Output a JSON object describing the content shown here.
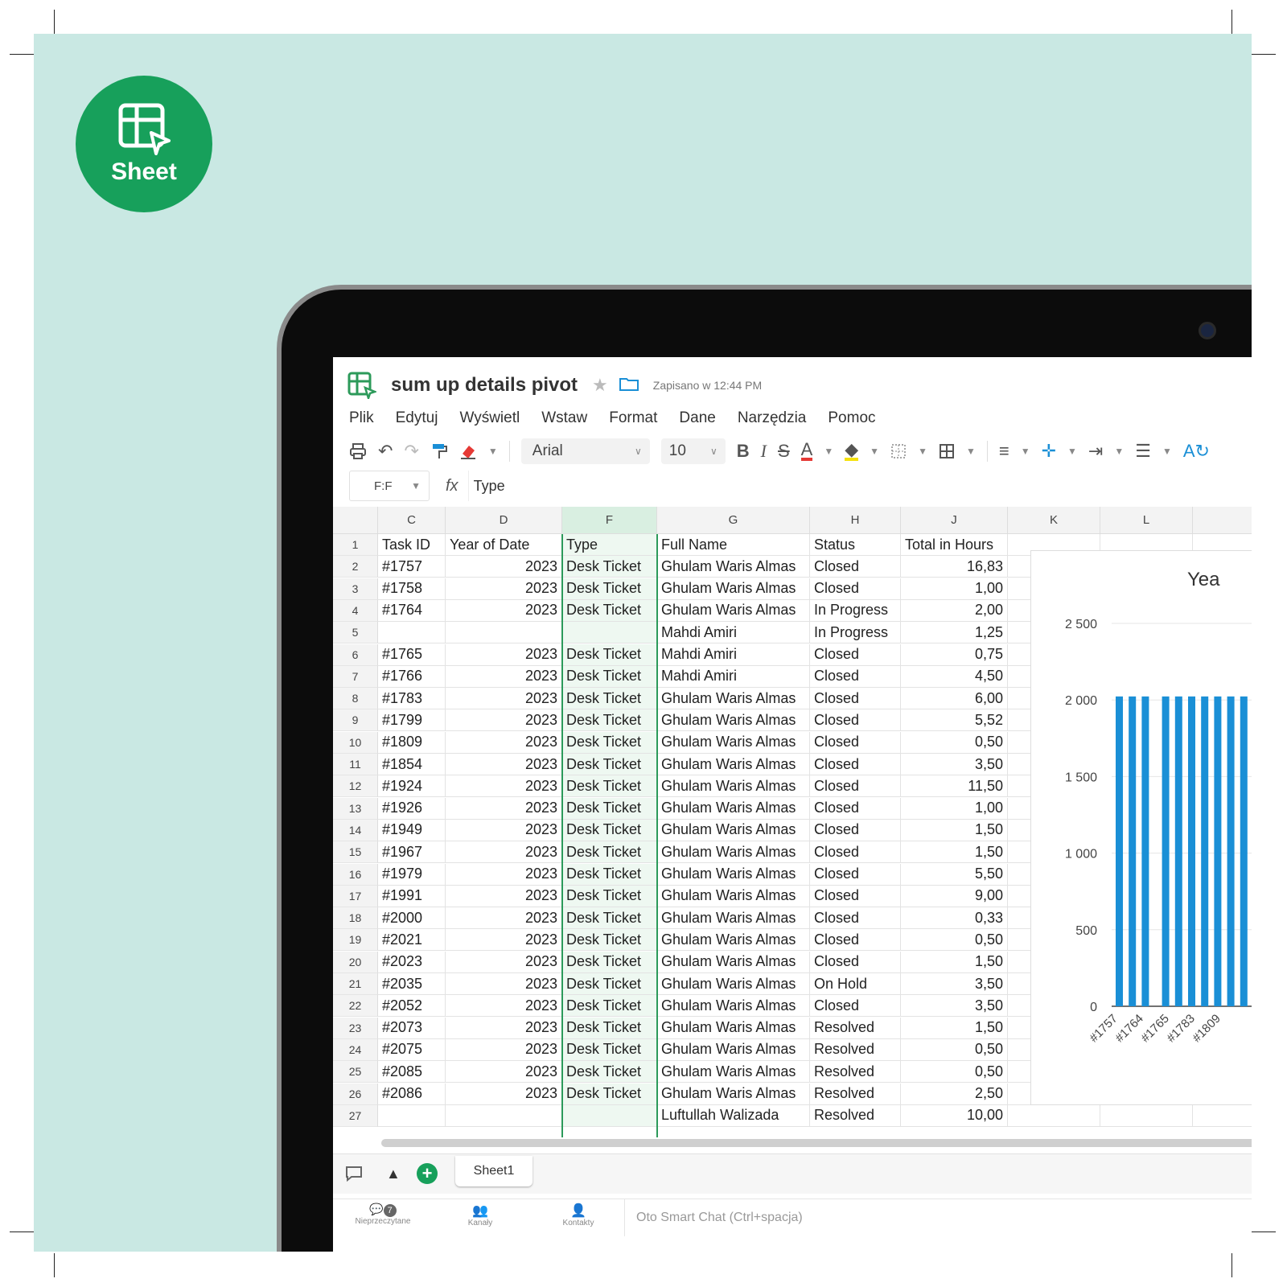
{
  "logo": {
    "label": "Sheet",
    "color": "#17a05b"
  },
  "app": {
    "title": "sum up details pivot",
    "saved_status": "Zapisano w 12:44 PM",
    "menu": [
      "Plik",
      "Edytuj",
      "Wyświetl",
      "Wstaw",
      "Format",
      "Dane",
      "Narzędzia",
      "Pomoc"
    ],
    "toolbar": {
      "font": "Arial",
      "font_size": "10"
    },
    "formula_bar": {
      "cell_ref": "F:F",
      "fx": "fx",
      "value": "Type"
    }
  },
  "grid": {
    "columns": [
      "C",
      "D",
      "F",
      "G",
      "H",
      "J",
      "K",
      "L"
    ],
    "selected_column": "F",
    "header_row": [
      "Task ID",
      "Year of Date",
      "Type",
      "Full Name",
      "Status",
      "Total in Hours"
    ],
    "rows": [
      {
        "n": "1",
        "c": "Task ID",
        "d": "Year of Date",
        "f": "Type",
        "g": "Full Name",
        "h": "Status",
        "j": "Total in Hours"
      },
      {
        "n": "2",
        "c": "#1757",
        "d": "2023",
        "f": "Desk Ticket",
        "g": "Ghulam Waris Almas",
        "h": "Closed",
        "j": "16,83"
      },
      {
        "n": "3",
        "c": "#1758",
        "d": "2023",
        "f": "Desk Ticket",
        "g": "Ghulam Waris Almas",
        "h": "Closed",
        "j": "1,00"
      },
      {
        "n": "4",
        "c": "#1764",
        "d": "2023",
        "f": "Desk Ticket",
        "g": "Ghulam Waris Almas",
        "h": "In Progress",
        "j": "2,00"
      },
      {
        "n": "5",
        "c": "",
        "d": "",
        "f": "",
        "g": "Mahdi Amiri",
        "h": "In Progress",
        "j": "1,25"
      },
      {
        "n": "6",
        "c": "#1765",
        "d": "2023",
        "f": "Desk Ticket",
        "g": "Mahdi Amiri",
        "h": "Closed",
        "j": "0,75"
      },
      {
        "n": "7",
        "c": "#1766",
        "d": "2023",
        "f": "Desk Ticket",
        "g": "Mahdi Amiri",
        "h": "Closed",
        "j": "4,50"
      },
      {
        "n": "8",
        "c": "#1783",
        "d": "2023",
        "f": "Desk Ticket",
        "g": "Ghulam Waris Almas",
        "h": "Closed",
        "j": "6,00"
      },
      {
        "n": "9",
        "c": "#1799",
        "d": "2023",
        "f": "Desk Ticket",
        "g": "Ghulam Waris Almas",
        "h": "Closed",
        "j": "5,52"
      },
      {
        "n": "10",
        "c": "#1809",
        "d": "2023",
        "f": "Desk Ticket",
        "g": "Ghulam Waris Almas",
        "h": "Closed",
        "j": "0,50"
      },
      {
        "n": "11",
        "c": "#1854",
        "d": "2023",
        "f": "Desk Ticket",
        "g": "Ghulam Waris Almas",
        "h": "Closed",
        "j": "3,50"
      },
      {
        "n": "12",
        "c": "#1924",
        "d": "2023",
        "f": "Desk Ticket",
        "g": "Ghulam Waris Almas",
        "h": "Closed",
        "j": "11,50"
      },
      {
        "n": "13",
        "c": "#1926",
        "d": "2023",
        "f": "Desk Ticket",
        "g": "Ghulam Waris Almas",
        "h": "Closed",
        "j": "1,00"
      },
      {
        "n": "14",
        "c": "#1949",
        "d": "2023",
        "f": "Desk Ticket",
        "g": "Ghulam Waris Almas",
        "h": "Closed",
        "j": "1,50"
      },
      {
        "n": "15",
        "c": "#1967",
        "d": "2023",
        "f": "Desk Ticket",
        "g": "Ghulam Waris Almas",
        "h": "Closed",
        "j": "1,50"
      },
      {
        "n": "16",
        "c": "#1979",
        "d": "2023",
        "f": "Desk Ticket",
        "g": "Ghulam Waris Almas",
        "h": "Closed",
        "j": "5,50"
      },
      {
        "n": "17",
        "c": "#1991",
        "d": "2023",
        "f": "Desk Ticket",
        "g": "Ghulam Waris Almas",
        "h": "Closed",
        "j": "9,00"
      },
      {
        "n": "18",
        "c": "#2000",
        "d": "2023",
        "f": "Desk Ticket",
        "g": "Ghulam Waris Almas",
        "h": "Closed",
        "j": "0,33"
      },
      {
        "n": "19",
        "c": "#2021",
        "d": "2023",
        "f": "Desk Ticket",
        "g": "Ghulam Waris Almas",
        "h": "Closed",
        "j": "0,50"
      },
      {
        "n": "20",
        "c": "#2023",
        "d": "2023",
        "f": "Desk Ticket",
        "g": "Ghulam Waris Almas",
        "h": "Closed",
        "j": "1,50"
      },
      {
        "n": "21",
        "c": "#2035",
        "d": "2023",
        "f": "Desk Ticket",
        "g": "Ghulam Waris Almas",
        "h": "On Hold",
        "j": "3,50"
      },
      {
        "n": "22",
        "c": "#2052",
        "d": "2023",
        "f": "Desk Ticket",
        "g": "Ghulam Waris Almas",
        "h": "Closed",
        "j": "3,50"
      },
      {
        "n": "23",
        "c": "#2073",
        "d": "2023",
        "f": "Desk Ticket",
        "g": "Ghulam Waris Almas",
        "h": "Resolved",
        "j": "1,50"
      },
      {
        "n": "24",
        "c": "#2075",
        "d": "2023",
        "f": "Desk Ticket",
        "g": "Ghulam Waris Almas",
        "h": "Resolved",
        "j": "0,50"
      },
      {
        "n": "25",
        "c": "#2085",
        "d": "2023",
        "f": "Desk Ticket",
        "g": "Ghulam Waris Almas",
        "h": "Resolved",
        "j": "0,50"
      },
      {
        "n": "26",
        "c": "#2086",
        "d": "2023",
        "f": "Desk Ticket",
        "g": "Ghulam Waris Almas",
        "h": "Resolved",
        "j": "2,50"
      },
      {
        "n": "27",
        "c": "",
        "d": "",
        "f": "",
        "g": "Luftullah Walizada",
        "h": "Resolved",
        "j": "10,00"
      }
    ]
  },
  "chart": {
    "title": "Yea",
    "bar_color": "#1a8fd6",
    "yticks": [
      "2 500",
      "2 000",
      "1 500",
      "1 000",
      "500",
      "0"
    ],
    "xticks": [
      "#1757",
      "#1764",
      "#1765",
      "#1783",
      "#1809"
    ]
  },
  "chart_data": {
    "type": "bar",
    "title": "Yea",
    "ylim": [
      0,
      2500
    ],
    "yticks": [
      0,
      500,
      1000,
      1500,
      2000,
      2500
    ],
    "categories": [
      "#1757",
      "#1764",
      "#1765",
      "#1783",
      "#1809"
    ],
    "series": [
      {
        "values": [
          2023,
          2023,
          2023,
          2023,
          2023,
          2023,
          2023,
          2023,
          2023,
          2023
        ]
      }
    ],
    "grid": true
  },
  "tabs": {
    "sheet": "Sheet1"
  },
  "statusbar": {
    "unread": "Nieprzeczytane",
    "unread_count": "7",
    "channels": "Kanały",
    "contacts": "Kontakty",
    "chat_placeholder": "Oto Smart Chat (Ctrl+spacja)"
  }
}
